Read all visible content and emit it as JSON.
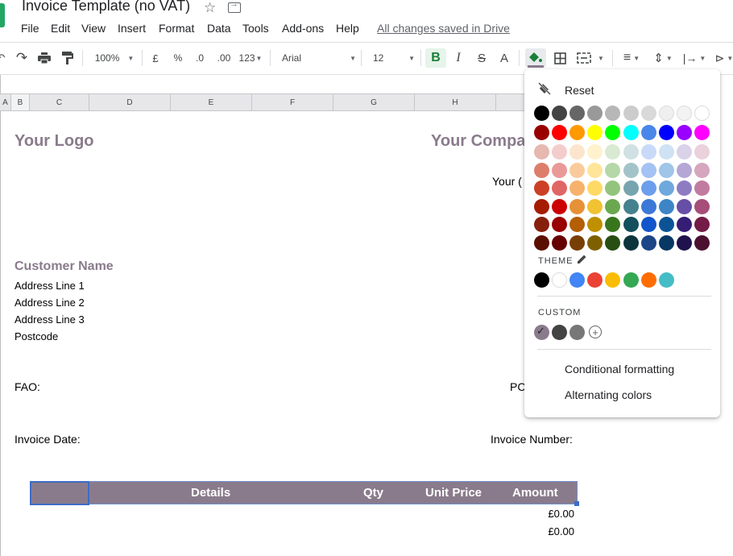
{
  "app": {
    "title": "Invoice Template (no VAT)",
    "save_status": "All changes saved in Drive",
    "menu": [
      "File",
      "Edit",
      "View",
      "Insert",
      "Format",
      "Data",
      "Tools",
      "Add-ons",
      "Help"
    ]
  },
  "toolbar": {
    "zoom": "100%",
    "currency": "£",
    "percent": "%",
    "decrease_decimal": ".0",
    "increase_decimal": ".00",
    "number_format": "123",
    "font": "Arial",
    "font_size": "12",
    "bold": "B",
    "italic": "I",
    "strikethrough": "S",
    "text_color": "A"
  },
  "columns": [
    "A",
    "B",
    "C",
    "D",
    "E",
    "F",
    "G",
    "H",
    ""
  ],
  "sheet": {
    "logo": "Your Logo",
    "company": "Your Compa",
    "company_line": "Your (",
    "customer_name": "Customer Name",
    "address": [
      "Address Line 1",
      "Address Line 2",
      "Address Line 3",
      "Postcode"
    ],
    "fao": "FAO:",
    "po": "PC",
    "invoice_date": "Invoice Date:",
    "invoice_number": "Invoice Number:",
    "table_headers": {
      "details": "Details",
      "qty": "Qty",
      "unit_price": "Unit Price",
      "amount": "Amount"
    },
    "amounts": [
      "£0.00",
      "£0.00"
    ],
    "accent_color": "#8a7b8c"
  },
  "fill_popup": {
    "reset": "Reset",
    "standard_colors": [
      [
        "#000000",
        "#434343",
        "#666666",
        "#999999",
        "#b7b7b7",
        "#cccccc",
        "#d9d9d9",
        "#efefef",
        "#f3f3f3",
        "#ffffff"
      ],
      [
        "#980000",
        "#ff0000",
        "#ff9900",
        "#ffff00",
        "#00ff00",
        "#00ffff",
        "#4a86e8",
        "#0000ff",
        "#9900ff",
        "#ff00ff"
      ],
      [
        "#e6b8af",
        "#f4cccc",
        "#fce5cd",
        "#fff2cc",
        "#d9ead3",
        "#d0e0e3",
        "#c9daf8",
        "#cfe2f3",
        "#d9d2e9",
        "#ead1dc"
      ],
      [
        "#dd7e6b",
        "#ea9999",
        "#f9cb9c",
        "#ffe599",
        "#b6d7a8",
        "#a2c4c9",
        "#a4c2f4",
        "#9fc5e8",
        "#b4a7d6",
        "#d5a6bd"
      ],
      [
        "#cc4125",
        "#e06666",
        "#f6b26b",
        "#ffd966",
        "#93c47d",
        "#76a5af",
        "#6d9eeb",
        "#6fa8dc",
        "#8e7cc3",
        "#c27ba0"
      ],
      [
        "#a61c00",
        "#cc0000",
        "#e69138",
        "#f1c232",
        "#6aa84f",
        "#45818e",
        "#3c78d8",
        "#3d85c6",
        "#674ea7",
        "#a64d79"
      ],
      [
        "#85200c",
        "#990000",
        "#b45f06",
        "#bf9000",
        "#38761d",
        "#134f5c",
        "#1155cc",
        "#0b5394",
        "#351c75",
        "#741b47"
      ],
      [
        "#5b0f00",
        "#660000",
        "#783f04",
        "#7f6000",
        "#274e13",
        "#0c343d",
        "#1c4587",
        "#073763",
        "#20124d",
        "#4c1130"
      ]
    ],
    "theme_label": "THEME",
    "theme_colors": [
      "#000000",
      "#ffffff",
      "#4285f4",
      "#ea4335",
      "#fbbc04",
      "#34a853",
      "#ff6d01",
      "#46bdc6"
    ],
    "custom_label": "CUSTOM",
    "custom_colors": [
      "#8a7b8c",
      "#434343",
      "#777777"
    ],
    "custom_selected_index": 0,
    "actions": [
      "Conditional formatting",
      "Alternating colors"
    ]
  }
}
